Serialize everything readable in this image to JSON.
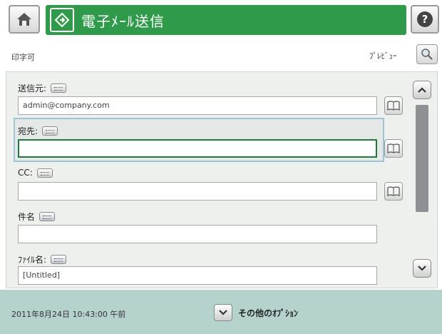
{
  "header": {
    "title": "電子ﾒｰﾙ送信",
    "accent": "#2f9a4a"
  },
  "icons": {
    "home": "home-icon",
    "app": "email-send-icon",
    "help": "help-icon",
    "preview": "magnifier-icon",
    "address_book": "address-book-icon",
    "keyboard": "keyboard-icon",
    "scroll_up": "chevron-up-icon",
    "scroll_down": "chevron-down-icon"
  },
  "status": {
    "text": "印字可",
    "preview_label": "ﾌﾟﾚﾋﾞｭｰ"
  },
  "form": {
    "from": {
      "label": "送信元:",
      "value": "admin@company.com"
    },
    "to": {
      "label": "宛先:",
      "value": ""
    },
    "cc": {
      "label": "CC:",
      "value": ""
    },
    "subject": {
      "label": "件名",
      "value": ""
    },
    "filename": {
      "label": "ﾌｧｲﾙ名:",
      "value": "[Untitled]"
    }
  },
  "footer": {
    "datetime": "2011年8月24日 10:43:00 午前",
    "more_options": "その他のｵﾌﾟｼｮﾝ",
    "bg": "#b5d3cc"
  }
}
